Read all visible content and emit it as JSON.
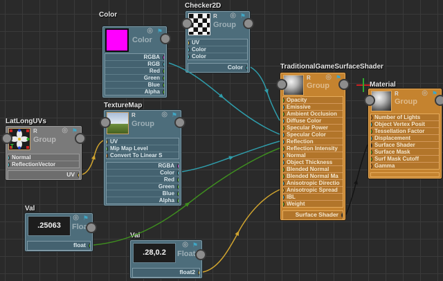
{
  "canvas": {
    "background": "#2a2a2a",
    "grid_color": "#3a3a3a",
    "grid_size_px": 25
  },
  "colors": {
    "node_blue": "#4d6d7b",
    "node_orange": "#c5832f",
    "node_gray": "#7a7a7a",
    "wire_cyan": "#2f9dab",
    "wire_green": "#3f8f1f",
    "wire_yellow": "#d0a42f",
    "wire_black": "#141414",
    "port_magenta": "#d93ad9",
    "port_cyan": "#3bbdc9",
    "port_green": "#53c229",
    "port_yellow": "#e8c33c",
    "port_value_orange": "#e07818",
    "port_black": "#0c0c0c",
    "swatch_magenta": "#ff00ff"
  },
  "icons": {
    "record": "◎",
    "flag": "⚑"
  },
  "nodes": {
    "color": {
      "title": "Color",
      "type_label": "Color",
      "swatch_css": "background:#ff00ff",
      "outputs": [
        {
          "label": "RGBA",
          "port": "magenta"
        },
        {
          "label": "RGB",
          "port": "cyan"
        },
        {
          "label": "Red",
          "port": "green"
        },
        {
          "label": "Green",
          "port": "green"
        },
        {
          "label": "Blue",
          "port": "green"
        },
        {
          "label": "Alpha",
          "port": "green"
        }
      ]
    },
    "checker": {
      "title": "Checker2D",
      "render_label": "R",
      "type_label": "Group",
      "inputs": [
        {
          "label": "UV",
          "port": "yellow"
        },
        {
          "label": "Color",
          "port": "cyan"
        },
        {
          "label": "Color",
          "port": "cyan"
        }
      ],
      "output": {
        "label": "Color",
        "port": "cyan"
      }
    },
    "texmap": {
      "title": "TextureMap",
      "render_label": "R",
      "type_label": "Group",
      "inputs": [
        {
          "label": "UV",
          "port": "yellow"
        },
        {
          "label": "Mip Map Level",
          "port": "green"
        },
        {
          "label": "Convert To Linear S",
          "port": "value",
          "letter": "V"
        }
      ],
      "outputs": [
        {
          "label": "RGBA",
          "port": "magenta"
        },
        {
          "label": "Color",
          "port": "cyan"
        },
        {
          "label": "Red",
          "port": "green"
        },
        {
          "label": "Green",
          "port": "green"
        },
        {
          "label": "Blue",
          "port": "green"
        },
        {
          "label": "Alpha",
          "port": "green"
        }
      ]
    },
    "latlong": {
      "title": "LatLongUVs",
      "render_label": "R",
      "type_label": "Group",
      "inputs": [
        {
          "label": "Normal",
          "port": "cyan"
        },
        {
          "label": "ReflectionVector",
          "port": "cyan"
        }
      ],
      "output": {
        "label": "UV",
        "port": "yellow"
      }
    },
    "val1": {
      "title": "Val",
      "type_label": "Float",
      "value": ".25063",
      "output": {
        "label": "float",
        "port": "green"
      }
    },
    "val2": {
      "title": "Val",
      "type_label": "Float2",
      "value": ".28,0.2",
      "output": {
        "label": "float2",
        "port": "yellow"
      }
    },
    "tgss": {
      "title": "TraditionalGameSurfaceShader",
      "render_label": "R",
      "type_label": "Group",
      "inputs": [
        {
          "label": "Opacity",
          "port": "green"
        },
        {
          "label": "Emissive",
          "port": "cyan"
        },
        {
          "label": "Ambient Occlusion",
          "port": "green"
        },
        {
          "label": "Diffuse Color",
          "port": "cyan"
        },
        {
          "label": "Specular Power",
          "port": "green"
        },
        {
          "label": "Specular Color",
          "port": "cyan"
        },
        {
          "label": "Reflection",
          "port": "cyan"
        },
        {
          "label": "Reflection Intensity",
          "port": "green"
        },
        {
          "label": "Normal",
          "port": "cyan"
        },
        {
          "label": "Object Thickness",
          "port": "cyan"
        },
        {
          "label": "Blended Normal",
          "port": "green"
        },
        {
          "label": "Blended Normal Ma",
          "port": "green"
        },
        {
          "label": "Anisotropic Directio",
          "port": "cyan"
        },
        {
          "label": "Anisotropic Spread",
          "port": "yellow"
        },
        {
          "label": "IBL",
          "port": "cyan"
        },
        {
          "label": "Weight",
          "port": "green"
        }
      ],
      "output": {
        "label": "Surface Shader",
        "port": "black"
      }
    },
    "material": {
      "title": "Material",
      "render_label": "R",
      "type_label": "Group",
      "inputs": [
        {
          "label": "Number of Lights",
          "port": "value",
          "letter": "V"
        },
        {
          "label": "Object Vertex Posit",
          "port": "cyan"
        },
        {
          "label": "Tessellation Factor",
          "port": "green"
        },
        {
          "label": "Displacement",
          "port": "cyan"
        },
        {
          "label": "Surface Shader",
          "port": "black"
        },
        {
          "label": "Surface Mask",
          "port": "green"
        },
        {
          "label": "Surf Mask Cutoff",
          "port": "green"
        },
        {
          "label": "Gamma",
          "port": "value",
          "letter": "V"
        }
      ]
    }
  },
  "connections": [
    {
      "from": "LatLongUVs.UV",
      "to": "TextureMap.UV",
      "color": "yellow"
    },
    {
      "from": "Val.float",
      "to": "TraditionalGameSurfaceShader.Reflection Intensity",
      "color": "green"
    },
    {
      "from": "Val.float2",
      "to": "TraditionalGameSurfaceShader.Anisotropic Spread",
      "color": "yellow"
    },
    {
      "from": "TextureMap.Color",
      "to": "TraditionalGameSurfaceShader.Reflection",
      "color": "cyan"
    },
    {
      "from": "Color.RGB",
      "to": "TraditionalGameSurfaceShader.Specular Color",
      "color": "cyan"
    },
    {
      "from": "Checker2D.Color",
      "to": "TraditionalGameSurfaceShader.Diffuse Color",
      "color": "cyan"
    },
    {
      "from": "TraditionalGameSurfaceShader.Surface Shader",
      "to": "Material.Surface Shader",
      "color": "black"
    }
  ]
}
